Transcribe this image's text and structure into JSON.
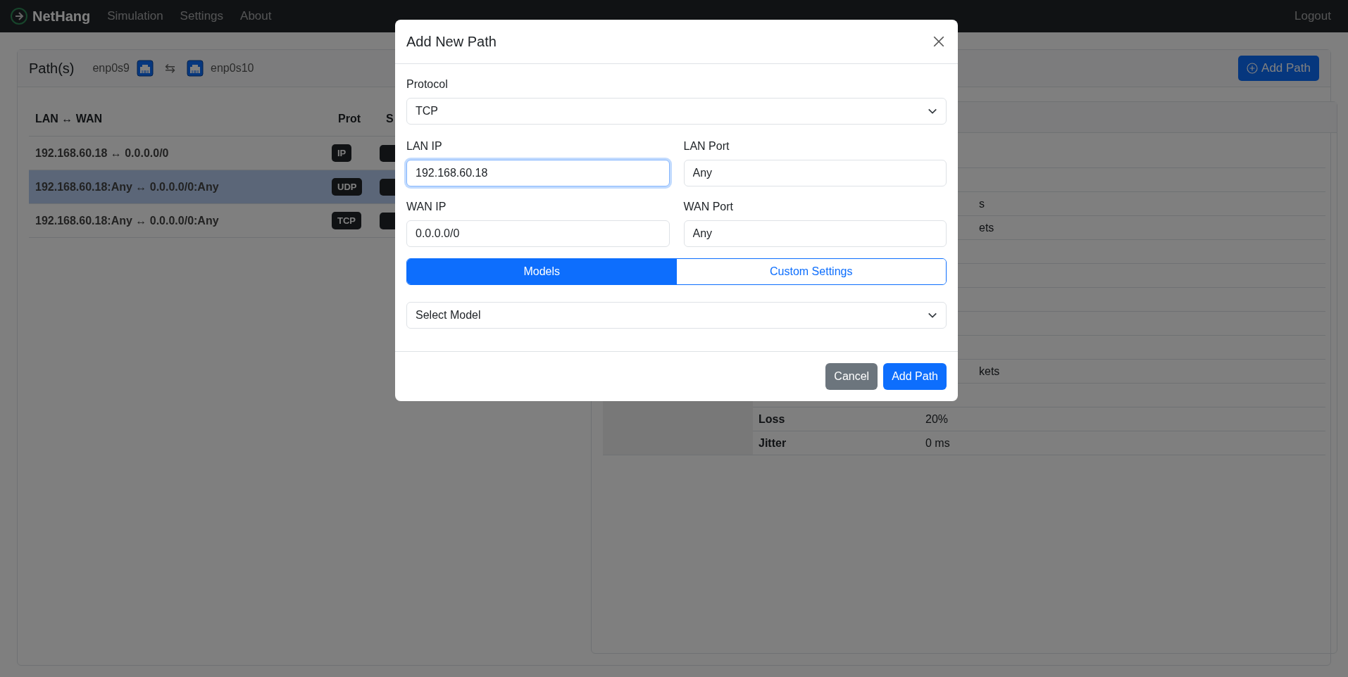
{
  "navbar": {
    "brand": "NetHang",
    "links": [
      "Simulation",
      "Settings",
      "About"
    ],
    "logout": "Logout"
  },
  "paths_card": {
    "title": "Path(s)",
    "lan_interface": "enp0s9",
    "swap_symbol": "⇆",
    "wan_interface": "enp0s10",
    "add_button": "Add Path",
    "table": {
      "columns": [
        "LAN ↔ WAN",
        "Prot",
        "S"
      ],
      "rows": [
        {
          "route": "192.168.60.18 ↔ 0.0.0.0/0",
          "protocol": "IP",
          "selected": false
        },
        {
          "route": "192.168.60.18:Any ↔ 0.0.0.0/0:Any",
          "protocol": "UDP",
          "selected": true
        },
        {
          "route": "192.168.60.18:Any ↔ 0.0.0.0/0:Any",
          "protocol": "TCP",
          "selected": false
        }
      ]
    },
    "details": {
      "rows": [
        {
          "kind": "blank"
        },
        {
          "kind": "blank"
        },
        {
          "kind": "clipped",
          "value": "s"
        },
        {
          "kind": "clipped",
          "value": "ets"
        },
        {
          "kind": "blank"
        },
        {
          "kind": "blank"
        },
        {
          "kind": "blank"
        },
        {
          "kind": "blank"
        },
        {
          "kind": "blank"
        },
        {
          "kind": "clipped",
          "value": "kets"
        },
        {
          "kind": "blank"
        },
        {
          "kind": "full",
          "label": "Loss",
          "value": "20%"
        },
        {
          "kind": "full",
          "label": "Jitter",
          "value": "0 ms"
        }
      ]
    }
  },
  "modal": {
    "title": "Add New Path",
    "protocol": {
      "label": "Protocol",
      "value": "TCP"
    },
    "fields": [
      {
        "label": "LAN IP",
        "value": "192.168.60.18",
        "focused": true
      },
      {
        "label": "LAN Port",
        "value": "Any",
        "focused": false
      },
      {
        "label": "WAN IP",
        "value": "0.0.0.0/0",
        "focused": false
      },
      {
        "label": "WAN Port",
        "value": "Any",
        "focused": false
      }
    ],
    "tabs": [
      {
        "label": "Models",
        "selected": true
      },
      {
        "label": "Custom Settings",
        "selected": false
      }
    ],
    "model_select": {
      "value": "Select Model"
    },
    "buttons": [
      {
        "label": "Cancel",
        "kind": "secondary"
      },
      {
        "label": "Add Path",
        "kind": "primary"
      }
    ]
  }
}
